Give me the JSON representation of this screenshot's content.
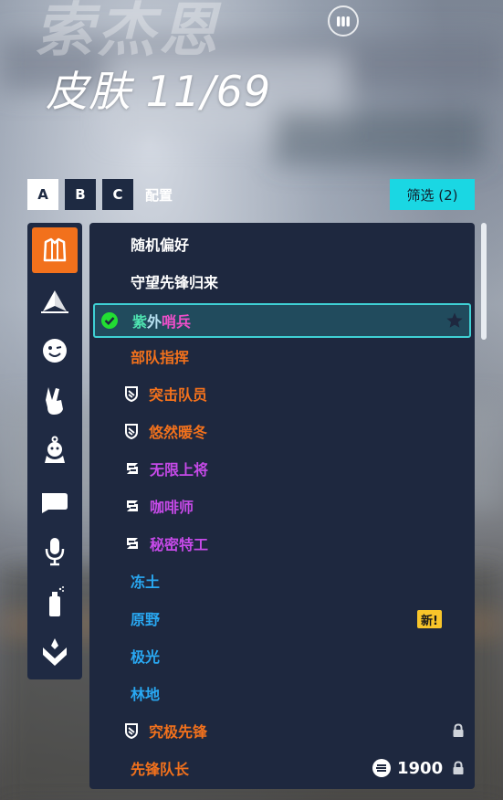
{
  "hero": {
    "name": "索杰恩",
    "skin_prefix": "皮肤",
    "skin_count": "11/69"
  },
  "loadout": {
    "buttons": [
      "A",
      "B",
      "C"
    ],
    "active": "A",
    "label": "配置"
  },
  "filter": {
    "label": "筛选 (2)"
  },
  "categories": [
    {
      "icon": "outfit-icon",
      "active": true
    },
    {
      "icon": "spray-wings-icon",
      "active": false
    },
    {
      "icon": "emote-icon",
      "active": false
    },
    {
      "icon": "victory-pose-icon",
      "active": false
    },
    {
      "icon": "souvenir-icon",
      "active": false
    },
    {
      "icon": "intro-highlight-icon",
      "active": false
    },
    {
      "icon": "voice-line-icon",
      "active": false
    },
    {
      "icon": "spray-can-icon",
      "active": false
    },
    {
      "icon": "weapon-charm-icon",
      "active": false
    }
  ],
  "skins": [
    {
      "label": "随机偏好",
      "color": "#ffffff",
      "icon": "",
      "selected": false
    },
    {
      "label": "守望先锋归来",
      "color": "#ffffff",
      "icon": "",
      "selected": false
    },
    {
      "label": "紫外哨兵",
      "color": "gradient",
      "icon": "check-icon",
      "selected": true,
      "favorite": true
    },
    {
      "label": "部队指挥",
      "color": "#f2711c",
      "icon": "",
      "selected": false
    },
    {
      "label": "突击队员",
      "color": "#f2711c",
      "icon": "battle-pass-icon",
      "selected": false
    },
    {
      "label": "悠然暖冬",
      "color": "#f2711c",
      "icon": "battle-pass-icon",
      "selected": false
    },
    {
      "label": "无限上将",
      "color": "#c64ae8",
      "icon": "season-icon",
      "selected": false
    },
    {
      "label": "咖啡师",
      "color": "#c64ae8",
      "icon": "season-icon",
      "selected": false
    },
    {
      "label": "秘密特工",
      "color": "#c64ae8",
      "icon": "season-icon",
      "selected": false
    },
    {
      "label": "冻土",
      "color": "#29a8f2",
      "icon": "",
      "selected": false
    },
    {
      "label": "原野",
      "color": "#29a8f2",
      "icon": "",
      "selected": false,
      "badge": "新!"
    },
    {
      "label": "极光",
      "color": "#29a8f2",
      "icon": "",
      "selected": false
    },
    {
      "label": "林地",
      "color": "#29a8f2",
      "icon": "",
      "selected": false
    },
    {
      "label": "究极先锋",
      "color": "#f2711c",
      "icon": "battle-pass-icon",
      "selected": false,
      "locked": true
    },
    {
      "label": "先锋队长",
      "color": "#f2711c",
      "icon": "",
      "selected": false,
      "locked": true,
      "price": "1900"
    }
  ],
  "gradient_text": {
    "part1": "紫",
    "part2": "外",
    "part3": "哨兵"
  }
}
